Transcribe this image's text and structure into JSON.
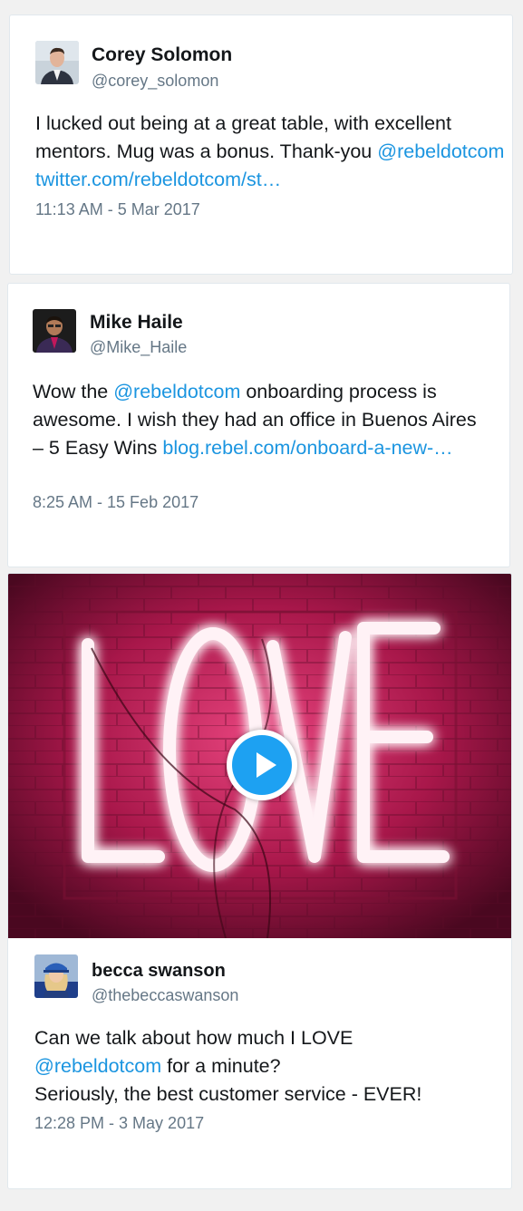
{
  "tweets": [
    {
      "name": "Corey Solomon",
      "handle": "@corey_solomon",
      "text_line1": "I lucked out being at a great table, with excellent mentors. Mug was a bonus. Thank-you ",
      "mention": "@rebeldotcom",
      "link": "twitter.com/rebeldotcom/st…",
      "timestamp": "11:13 AM - 5 Mar 2017"
    },
    {
      "name": "Mike Haile",
      "handle": "@Mike_Haile",
      "text_before": "Wow the ",
      "mention": "@rebeldotcom",
      "text_after": " onboarding process is awesome. I wish they had an office in Buenos Aires – 5 Easy Wins ",
      "link": "blog.rebel.com/onboard-a-new-…",
      "timestamp": "8:25 AM - 15 Feb 2017"
    },
    {
      "name": "becca swanson",
      "handle": "@thebeccaswanson",
      "text_line1": "Can we talk about how much I LOVE",
      "mention": "@rebeldotcom",
      "text_line2_after": " for a minute?",
      "text_line3": "Seriously, the best customer service - EVER!",
      "timestamp": "12:28 PM - 3 May 2017"
    }
  ],
  "media": {
    "neon_text": "LOVE"
  },
  "colors": {
    "link": "#1b95e0",
    "play_button": "#1da1f2",
    "neon": "#ff3b8a"
  },
  "icons": {
    "play": "play-icon"
  }
}
